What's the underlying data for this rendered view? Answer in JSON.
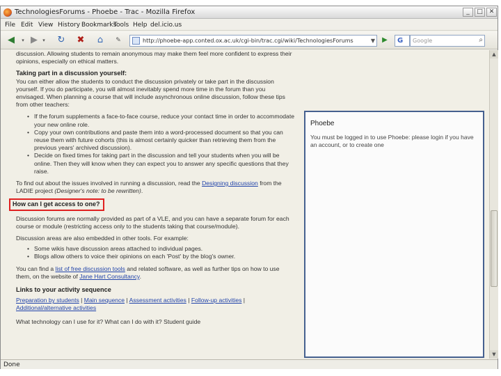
{
  "window": {
    "title": "TechnologiesForums - Phoebe - Trac - Mozilla Firefox",
    "buttons": {
      "minimize": "_",
      "maximize": "□",
      "close": "✕"
    }
  },
  "menubar": [
    "File",
    "Edit",
    "View",
    "History",
    "Bookmarks",
    "Tools",
    "Help",
    "del.icio.us"
  ],
  "navbar": {
    "back_icon": "back-arrow-icon",
    "forward_icon": "forward-arrow-icon",
    "url": "http://phoebe-app.conted.ox.ac.uk/cgi-bin/trac.cgi/wiki/TechnologiesForums",
    "search_engine": "G",
    "search_placeholder": "Google"
  },
  "content": {
    "intro_tail": "discussion. Allowing students to remain anonymous may make them feel more confident to express their opinions, especially on ethical matters.",
    "section_taking_part": {
      "heading": "Taking part in a discussion yourself:",
      "paragraph": "You can either allow the students to conduct the discussion privately or take part in the discussion yourself. If you do participate, you will almost inevitably spend more time in the forum than you envisaged. When planning a course that will include asynchronous online discussion, follow these tips from other teachers:",
      "bullets": [
        "If the forum supplements a face-to-face course, reduce your contact time in order to accommodate your new online role.",
        "Copy your own contributions and paste them into a word-processed document so that you can reuse them with future cohorts (this is almost certainly quicker than retrieving them from the previous years' archived discussion).",
        "Decide on fixed times for taking part in the discussion and tell your students when you will be online. Then they will know when they can expect you to answer any specific questions that they raise."
      ],
      "find_out_pre": "To find out about the issues involved in running a discussion, read the",
      "find_out_link": "Designing discussion",
      "find_out_mid": "from the LADIE project",
      "find_out_note": "(Designer's note: to be rewritten)",
      "find_out_end": "."
    },
    "section_access": {
      "heading": "How can I get access to one?",
      "paragraph1": "Discussion forums are normally provided as part of a VLE, and you can have a separate forum for each course or module (restricting access only to the students taking that course/module).",
      "paragraph2": "Discussion areas are also embedded in other tools. For example:",
      "bullets": [
        "Some wikis have discussion areas attached to individual pages.",
        "Blogs allow others to voice their opinions on each 'Post' by the blog's owner."
      ],
      "find_pre": "You can find a",
      "find_link": "list of free discussion tools",
      "find_mid": "and related software, as well as further tips on how to use them, on the website of",
      "find_link2": "Jane Hart Consultancy",
      "find_end": "."
    },
    "section_activity": {
      "heading": "Links to your activity sequence",
      "links": [
        "Preparation by students",
        "Main sequence",
        "Assessment activities",
        "Follow-up activities",
        "Additional/alternative activities"
      ],
      "separator": "|"
    },
    "cutoff_line": "What technology can I use for it? What can I do with it? Student guide"
  },
  "phoebe_panel": {
    "title": "Phoebe",
    "message": "You must be logged in to use Phoebe: please login if you have an account, or to create one"
  },
  "status": "Done"
}
